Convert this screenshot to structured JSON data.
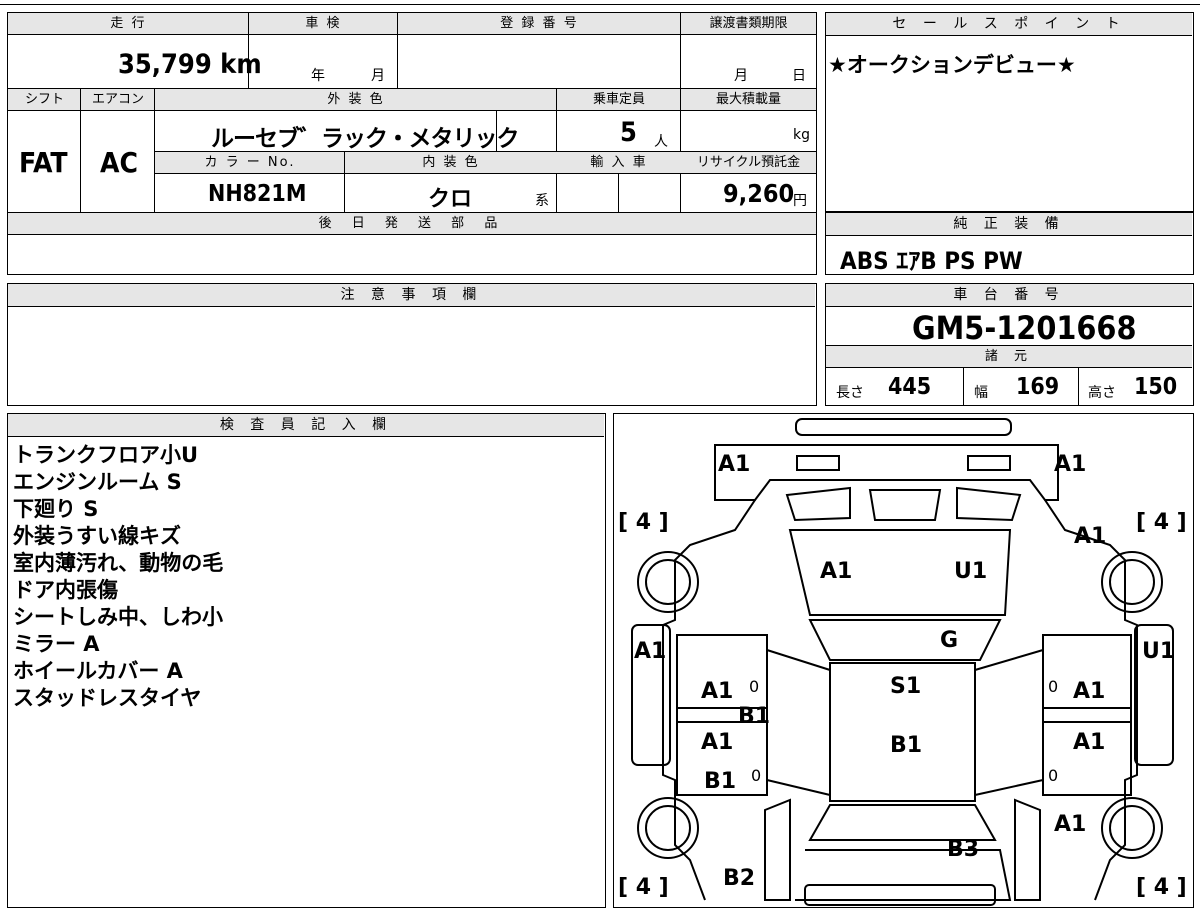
{
  "vehicle": {
    "mileage_label": "走 行",
    "mileage": "35,799 km",
    "inspection_label": "車 検",
    "inspection_year": "年",
    "inspection_month": "月",
    "registration_label": "登 録 番 号",
    "transfer_label": "譲渡書類期限",
    "transfer_month": "月",
    "transfer_day": "日",
    "shift_label": "シフト",
    "shift": "FAT",
    "aircon_label": "エアコン",
    "aircon": "AC",
    "exterior_color_label": "外 装 色",
    "exterior_color": "ルーセブ゛ラック・メタリック",
    "capacity_label": "乗車定員",
    "capacity": "5",
    "capacity_unit": "人",
    "max_load_label": "最大積載量",
    "max_load_unit": "kg",
    "color_no_label": "カ ラ ー No.",
    "color_no": "NH821M",
    "interior_color_label": "内 装 色",
    "interior_color": "クロ",
    "interior_suffix": "系",
    "import_label": "輸 入 車",
    "recycle_label": "リサイクル預託金",
    "recycle_fee": "9,260",
    "recycle_unit": "円",
    "later_parts_label": "後 日 発 送 部 品"
  },
  "sales_point": {
    "label": "セ ー ル ス ポ イ ン ト",
    "text": "★オークションデビュー★"
  },
  "equipment": {
    "label": "純 正 装 備",
    "text": "ABS ｴｱB PS PW"
  },
  "caution": {
    "label": "注 意 事 項 欄"
  },
  "chassis": {
    "label": "車 台 番 号",
    "number": "GM5-1201668",
    "spec_label": "諸 元",
    "length_label": "長さ",
    "length": "445",
    "width_label": "幅",
    "width": "169",
    "height_label": "高さ",
    "height": "150"
  },
  "inspector": {
    "label": "検 査 員 記 入 欄",
    "notes": [
      "トランクフロア小U",
      "エンジンルーム S",
      "下廻り S",
      "外装うすい線キズ",
      "室内薄汚れ、動物の毛",
      "ドア内張傷",
      "シートしみ中、しわ小",
      "ミラー A",
      "ホイールカバー A",
      "スタッドレスタイヤ"
    ]
  },
  "diagram": {
    "marks": {
      "rear_left": "A1",
      "rear_right": "A1",
      "tire_rl": "[ 4 ]",
      "tire_rr": "[ 4 ]",
      "rear_quarter_right": "A1",
      "trunk_left": "A1",
      "trunk_right": "U1",
      "rear_glass": "G",
      "side_left": "A1",
      "side_right": "U1",
      "roof": "S1",
      "rear_door_left": "A1",
      "sill_left": "B1",
      "rear_door_right": "A1",
      "front_door_left": "A1",
      "roof_front": "B1",
      "front_door_right": "A1",
      "front_fender_left": "B1",
      "front_fender_right": "A1",
      "hood": "B3",
      "front_bumper_left": "B2",
      "tire_fl": "[ 4 ]",
      "tire_fr": "[ 4 ]",
      "zero_1": "0",
      "zero_2": "0",
      "zero_3": "0",
      "zero_4": "0"
    }
  }
}
